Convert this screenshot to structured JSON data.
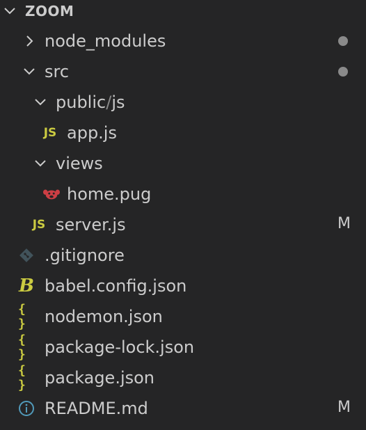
{
  "explorer": {
    "root_title": "ZOOM",
    "items": [
      {
        "label": "node_modules",
        "type": "folder",
        "expanded": false,
        "status": "dot"
      },
      {
        "label": "src",
        "type": "folder",
        "expanded": true,
        "status": "dot"
      },
      {
        "label_a": "public",
        "label_sep": "/",
        "label_b": "js",
        "type": "folder",
        "expanded": true
      },
      {
        "label": "app.js",
        "type": "file",
        "icon": "js-icon"
      },
      {
        "label": "views",
        "type": "folder",
        "expanded": true
      },
      {
        "label": "home.pug",
        "type": "file",
        "icon": "pug-icon"
      },
      {
        "label": "server.js",
        "type": "file",
        "icon": "js-icon",
        "status": "M"
      },
      {
        "label": ".gitignore",
        "type": "file",
        "icon": "git-icon"
      },
      {
        "label": "babel.config.json",
        "type": "file",
        "icon": "babel-icon"
      },
      {
        "label": "nodemon.json",
        "type": "file",
        "icon": "json-icon"
      },
      {
        "label": "package-lock.json",
        "type": "file",
        "icon": "json-icon"
      },
      {
        "label": "package.json",
        "type": "file",
        "icon": "json-icon"
      },
      {
        "label": "README.md",
        "type": "file",
        "icon": "info-icon",
        "status": "M"
      }
    ],
    "icon_text": {
      "js": "JS",
      "json": "{ }",
      "babel": "B"
    },
    "colors": {
      "background": "#252526",
      "text": "#cccccc",
      "js_icon": "#cbcb41",
      "pug_icon": "#cc3e44",
      "git_icon": "#41535b",
      "info_icon": "#519aba",
      "modified_dot": "#8a8a8a"
    }
  }
}
